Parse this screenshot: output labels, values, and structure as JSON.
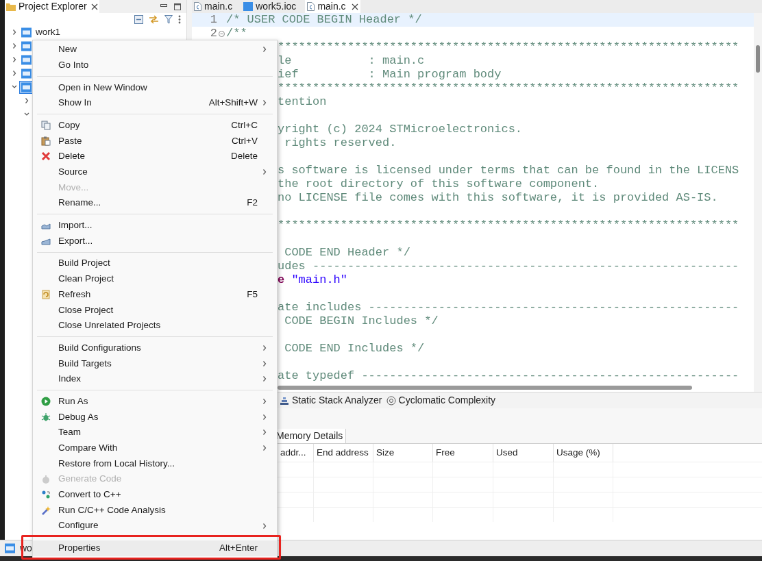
{
  "explorer": {
    "title": "Project Explorer",
    "tree": [
      {
        "label": "work1",
        "expanded": false,
        "selected": false
      },
      {
        "expanded": false,
        "selected": false
      },
      {
        "expanded": false,
        "selected": false
      },
      {
        "expanded": false,
        "selected": false
      },
      {
        "expanded": true,
        "selected": true,
        "children": [
          {
            "expanded": false
          },
          {
            "expanded": true
          }
        ]
      }
    ]
  },
  "editor": {
    "tabs": [
      {
        "label": "main.c",
        "kind": "c",
        "selected": false
      },
      {
        "label": "work5.ioc",
        "kind": "mx",
        "selected": false
      },
      {
        "label": "main.c",
        "kind": "c",
        "selected": true
      }
    ],
    "lines": [
      {
        "number": "1",
        "text": "/* USER CODE BEGIN Header */",
        "current": true,
        "foldable": false
      },
      {
        "number": "2",
        "text": "/**",
        "current": false,
        "foldable": true
      }
    ],
    "fragments": [
      {
        "segments": [
          {
            "kind": "comment",
            "text": "******************************************************************"
          }
        ],
        "blank_after": false
      },
      {
        "segments": [
          {
            "kind": "comment",
            "text": "le           : main.c"
          }
        ],
        "blank_after": false
      },
      {
        "segments": [
          {
            "kind": "comment",
            "text": "ief          : Main program body"
          }
        ],
        "blank_after": false
      },
      {
        "segments": [
          {
            "kind": "comment",
            "text": "******************************************************************"
          }
        ],
        "blank_after": false
      },
      {
        "segments": [
          {
            "kind": "comment",
            "text": "tention"
          }
        ],
        "blank_after": true
      },
      {
        "segments": [
          {
            "kind": "comment",
            "text": "yright (c) 2024 STMicroelectronics."
          }
        ],
        "blank_after": false
      },
      {
        "segments": [
          {
            "kind": "comment",
            "text": " rights reserved."
          }
        ],
        "blank_after": true
      },
      {
        "segments": [
          {
            "kind": "comment",
            "text": "s software is licensed under terms that can be found in the LICENS"
          }
        ],
        "blank_after": false
      },
      {
        "segments": [
          {
            "kind": "comment",
            "text": "the root directory of this software component."
          }
        ],
        "blank_after": false
      },
      {
        "segments": [
          {
            "kind": "comment",
            "text": "no LICENSE file comes with this software, it is provided AS-IS."
          }
        ],
        "blank_after": true
      },
      {
        "segments": [
          {
            "kind": "comment",
            "text": "******************************************************************"
          }
        ],
        "blank_after": true
      },
      {
        "segments": [
          {
            "kind": "comment",
            "text": " CODE END Header */"
          }
        ],
        "blank_after": false
      },
      {
        "segments": [
          {
            "kind": "comment",
            "text": "udes -------------------------------------------------------------"
          }
        ],
        "blank_after": false
      },
      {
        "segments": [
          {
            "kind": "keyword",
            "text": "e"
          },
          {
            "kind": "string",
            "text": " \"main.h\""
          }
        ],
        "blank_after": true
      },
      {
        "segments": [
          {
            "kind": "comment",
            "text": "ate includes -----------------------------------------------------"
          }
        ],
        "blank_after": false
      },
      {
        "segments": [
          {
            "kind": "comment",
            "text": " CODE BEGIN Includes */"
          }
        ],
        "blank_after": true
      },
      {
        "segments": [
          {
            "kind": "comment",
            "text": " CODE END Includes */"
          }
        ],
        "blank_after": true
      },
      {
        "segments": [
          {
            "kind": "comment",
            "text": "ate typedef ------------------------------------------------------"
          }
        ],
        "blank_after": false
      }
    ]
  },
  "bottom_panel": {
    "tabs": [
      {
        "label": "Static Stack Analyzer",
        "kind": "stack"
      },
      {
        "label": "Cyclomatic Complexity",
        "kind": "cyclo"
      }
    ],
    "subtab": "Memory Details",
    "columns": [
      "addr...",
      "End address",
      "Size",
      "Free",
      "Used",
      "Usage (%)"
    ]
  },
  "status_bar": {
    "text": "wo"
  },
  "menu": {
    "groups": [
      {
        "items": [
          {
            "label": "New",
            "kind": "plain",
            "submenu": true,
            "disabled": false,
            "highlighted": false,
            "boxed": false
          },
          {
            "label": "Go Into",
            "kind": "plain",
            "submenu": false,
            "disabled": false,
            "highlighted": false,
            "boxed": false
          }
        ]
      },
      {
        "items": [
          {
            "label": "Open in New Window",
            "kind": "plain",
            "submenu": false,
            "disabled": false,
            "highlighted": false,
            "boxed": false
          },
          {
            "label": "Show In",
            "shortcut": "Alt+Shift+W",
            "kind": "plain",
            "submenu": true,
            "disabled": false,
            "highlighted": false,
            "boxed": false
          }
        ]
      },
      {
        "items": [
          {
            "label": "Copy",
            "shortcut": "Ctrl+C",
            "kind": "copy",
            "submenu": false,
            "disabled": false,
            "highlighted": false,
            "boxed": false
          },
          {
            "label": "Paste",
            "shortcut": "Ctrl+V",
            "kind": "paste",
            "submenu": false,
            "disabled": false,
            "highlighted": false,
            "boxed": false
          },
          {
            "label": "Delete",
            "shortcut": "Delete",
            "kind": "delete",
            "submenu": false,
            "disabled": false,
            "highlighted": false,
            "boxed": false
          },
          {
            "label": "Source",
            "kind": "plain",
            "submenu": true,
            "disabled": false,
            "highlighted": false,
            "boxed": false
          },
          {
            "label": "Move...",
            "kind": "plain",
            "submenu": false,
            "disabled": true,
            "highlighted": false,
            "boxed": false
          },
          {
            "label": "Rename...",
            "shortcut": "F2",
            "kind": "plain",
            "submenu": false,
            "disabled": false,
            "highlighted": false,
            "boxed": false
          }
        ]
      },
      {
        "items": [
          {
            "label": "Import...",
            "kind": "import",
            "submenu": false,
            "disabled": false,
            "highlighted": false,
            "boxed": false
          },
          {
            "label": "Export...",
            "kind": "export",
            "submenu": false,
            "disabled": false,
            "highlighted": false,
            "boxed": false
          }
        ]
      },
      {
        "items": [
          {
            "label": "Build Project",
            "kind": "plain",
            "submenu": false,
            "disabled": false,
            "highlighted": false,
            "boxed": false
          },
          {
            "label": "Clean Project",
            "kind": "plain",
            "submenu": false,
            "disabled": false,
            "highlighted": false,
            "boxed": false
          },
          {
            "label": "Refresh",
            "shortcut": "F5",
            "kind": "refresh",
            "submenu": false,
            "disabled": false,
            "highlighted": false,
            "boxed": false
          },
          {
            "label": "Close Project",
            "kind": "plain",
            "submenu": false,
            "disabled": false,
            "highlighted": false,
            "boxed": false
          },
          {
            "label": "Close Unrelated Projects",
            "kind": "plain",
            "submenu": false,
            "disabled": false,
            "highlighted": false,
            "boxed": false
          }
        ]
      },
      {
        "items": [
          {
            "label": "Build Configurations",
            "kind": "plain",
            "submenu": true,
            "disabled": false,
            "highlighted": false,
            "boxed": false
          },
          {
            "label": "Build Targets",
            "kind": "plain",
            "submenu": true,
            "disabled": false,
            "highlighted": false,
            "boxed": false
          },
          {
            "label": "Index",
            "kind": "plain",
            "submenu": true,
            "disabled": false,
            "highlighted": false,
            "boxed": false
          }
        ]
      },
      {
        "items": [
          {
            "label": "Run As",
            "kind": "run",
            "submenu": true,
            "disabled": false,
            "highlighted": false,
            "boxed": false
          },
          {
            "label": "Debug As",
            "kind": "debug",
            "submenu": true,
            "disabled": false,
            "highlighted": false,
            "boxed": false
          },
          {
            "label": "Team",
            "kind": "plain",
            "submenu": true,
            "disabled": false,
            "highlighted": false,
            "boxed": false
          },
          {
            "label": "Compare With",
            "kind": "plain",
            "submenu": true,
            "disabled": false,
            "highlighted": false,
            "boxed": false
          },
          {
            "label": "Restore from Local History...",
            "kind": "plain",
            "submenu": false,
            "disabled": false,
            "highlighted": false,
            "boxed": false
          },
          {
            "label": "Generate Code",
            "kind": "generate",
            "submenu": false,
            "disabled": true,
            "highlighted": false,
            "boxed": false
          },
          {
            "label": "Convert to C++",
            "kind": "convert",
            "submenu": false,
            "disabled": false,
            "highlighted": false,
            "boxed": false
          },
          {
            "label": "Run C/C++ Code Analysis",
            "kind": "analysis",
            "submenu": false,
            "disabled": false,
            "highlighted": false,
            "boxed": false
          },
          {
            "label": "Configure",
            "kind": "plain",
            "submenu": true,
            "disabled": false,
            "highlighted": false,
            "boxed": false
          }
        ]
      },
      {
        "items": [
          {
            "label": "Properties",
            "shortcut": "Alt+Enter",
            "kind": "plain",
            "submenu": false,
            "disabled": false,
            "highlighted": true,
            "boxed": true
          }
        ]
      }
    ]
  }
}
